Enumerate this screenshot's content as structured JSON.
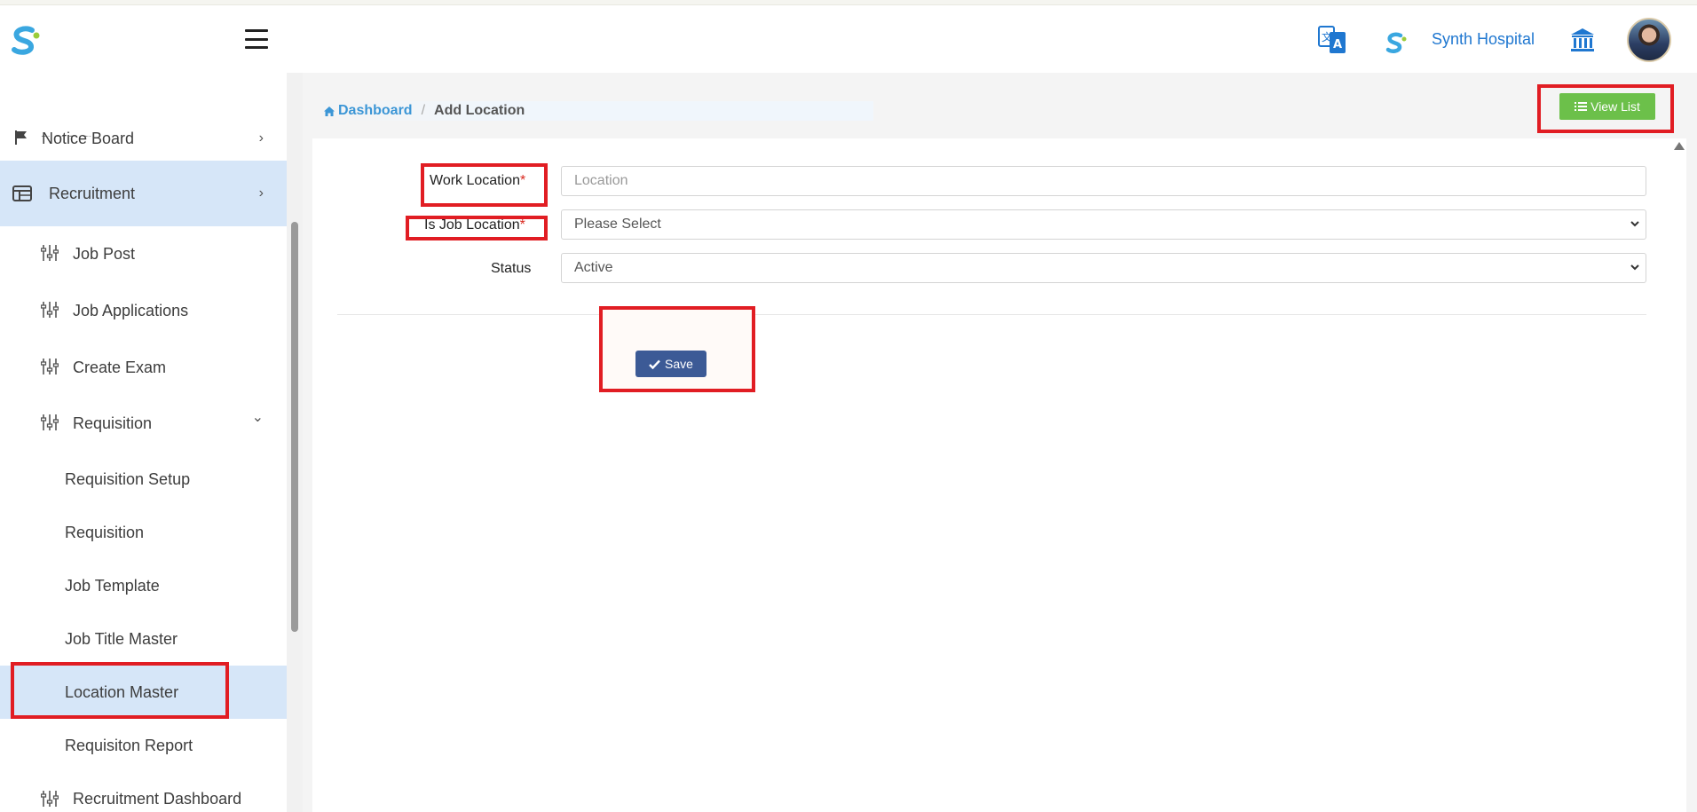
{
  "header": {
    "hospital_name": "Synth Hospital",
    "icons": [
      "logo-icon",
      "hamburger-menu-icon",
      "translate-icon",
      "brand-icon",
      "bank-icon",
      "user-avatar"
    ]
  },
  "sidebar": {
    "items": [
      {
        "label": "Notice Board",
        "icon": "flag-icon",
        "chevron": "›"
      },
      {
        "label": "Recruitment",
        "icon": "table-icon",
        "chevron": "›"
      },
      {
        "label": "Job Post",
        "icon": "sliders-icon"
      },
      {
        "label": "Job Applications",
        "icon": "sliders-icon"
      },
      {
        "label": "Create Exam",
        "icon": "sliders-icon"
      },
      {
        "label": "Requisition",
        "icon": "sliders-icon",
        "chevron": "⌄"
      },
      {
        "label": "Requisition Setup"
      },
      {
        "label": "Requisition"
      },
      {
        "label": "Job Template"
      },
      {
        "label": "Job Title Master"
      },
      {
        "label": "Location Master"
      },
      {
        "label": "Requisiton Report"
      },
      {
        "label": "Recruitment Dashboard",
        "icon": "sliders-icon"
      }
    ]
  },
  "breadcrumb": {
    "home": "Dashboard",
    "separator": "/",
    "current": "Add Location"
  },
  "toolbar": {
    "view_list_label": "View List"
  },
  "form": {
    "work_location_label": "Work Location",
    "work_location_placeholder": "Location",
    "is_job_location_label": "Is Job Location",
    "is_job_location_value": "Please Select",
    "status_label": "Status",
    "status_value": "Active",
    "required_mark": "*",
    "save_label": "Save"
  },
  "colors": {
    "accent_blue": "#1f77d0",
    "active_row": "#d6e6f8",
    "view_list_green": "#6cc04a",
    "save_blue": "#3c5a96",
    "annotation_red": "#e11d23"
  }
}
